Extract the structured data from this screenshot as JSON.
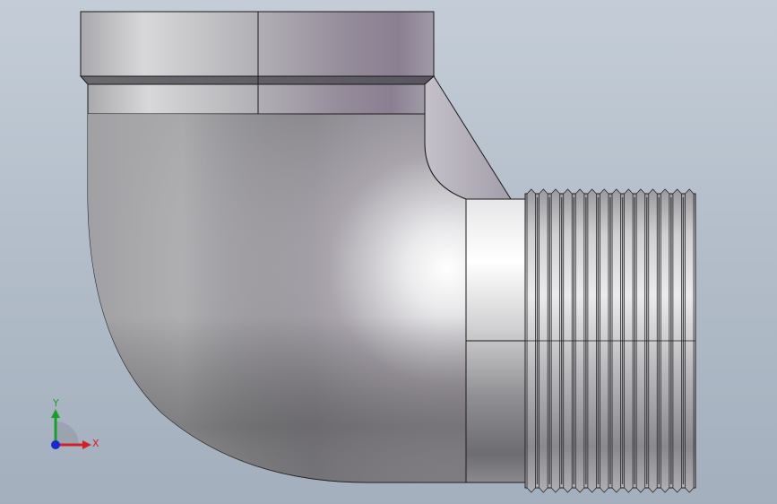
{
  "viewport": {
    "background_top": "#c4cdd7",
    "background_bottom": "#a3afbd"
  },
  "model": {
    "part_type": "90-degree street elbow pipe fitting",
    "material_color": "#c8c8cc",
    "edge_color": "#1a1a1a",
    "thread_count": 14
  },
  "triad": {
    "x_label": "X",
    "y_label": "Y",
    "x_color": "#d0202a",
    "y_color": "#1aa02a",
    "z_color": "#1a2ad0"
  }
}
